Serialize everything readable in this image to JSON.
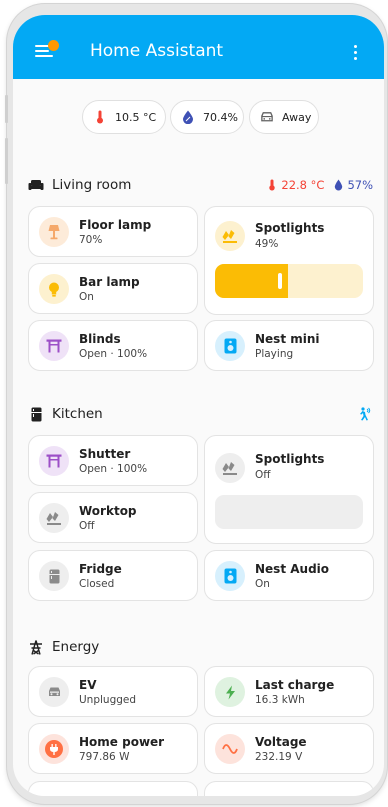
{
  "app": {
    "title": "Home Assistant"
  },
  "chips": [
    {
      "icon": "thermometer-icon",
      "text": "10.5 °C",
      "color": "#f44336"
    },
    {
      "icon": "water-percent-icon",
      "text": "70.4%",
      "color": "#3f51b5"
    },
    {
      "icon": "car-icon",
      "text": "Away",
      "color": "#616161"
    }
  ],
  "sections": {
    "living": {
      "title": "Living room",
      "temperature": "22.8 °C",
      "humidity": "57%",
      "tiles": {
        "floor_lamp": {
          "name": "Floor lamp",
          "state": "70%"
        },
        "spotlights": {
          "name": "Spotlights",
          "state": "49%",
          "brightness": 0.49
        },
        "bar_lamp": {
          "name": "Bar lamp",
          "state": "On"
        },
        "blinds": {
          "name": "Blinds",
          "state": "Open · 100%"
        },
        "nest_mini": {
          "name": "Nest mini",
          "state": "Playing"
        }
      }
    },
    "kitchen": {
      "title": "Kitchen",
      "tiles": {
        "shutter": {
          "name": "Shutter",
          "state": "Open · 100%"
        },
        "spotlights": {
          "name": "Spotlights",
          "state": "Off"
        },
        "worktop": {
          "name": "Worktop",
          "state": "Off"
        },
        "fridge": {
          "name": "Fridge",
          "state": "Closed"
        },
        "nest_audio": {
          "name": "Nest Audio",
          "state": "On"
        }
      }
    },
    "energy": {
      "title": "Energy",
      "tiles": {
        "ev": {
          "name": "EV",
          "state": "Unplugged"
        },
        "last_charge": {
          "name": "Last charge",
          "state": "16.3 kWh"
        },
        "home_power": {
          "name": "Home power",
          "state": "797.86 W"
        },
        "voltage": {
          "name": "Voltage",
          "state": "232.19 V"
        }
      }
    }
  },
  "colors": {
    "appbar": "#03a9f4",
    "light_on": "#fbbc05",
    "cover": "#9c4fc7",
    "media": "#03a9f4",
    "energy_green": "#4caf50",
    "energy_orange": "#ff7043",
    "inactive": "#8a8a8a"
  }
}
